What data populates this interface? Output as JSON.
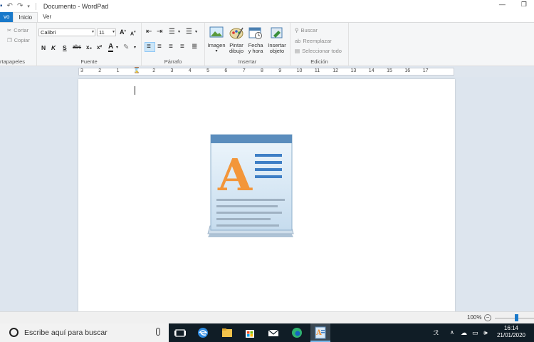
{
  "window": {
    "title": "Documento - WordPad",
    "minimize": "—",
    "restore": "❐"
  },
  "tabs": {
    "file": "vo",
    "home": "Inicio",
    "view": "Ver"
  },
  "clipboard": {
    "label": "rtapapeles",
    "cut": "Cortar",
    "copy": "Copiar"
  },
  "font": {
    "label": "Fuente",
    "family": "Calibri",
    "size": "11",
    "bold": "N",
    "italic": "K",
    "underline": "S",
    "strike": "abc",
    "sub": "x₂",
    "sup": "x²",
    "color_letter": "A"
  },
  "paragraph": {
    "label": "Párrafo"
  },
  "insert": {
    "label": "Insertar",
    "image": "Imagen",
    "paint1": "Pintar",
    "paint2": "dibujo",
    "date1": "Fecha",
    "date2": "y hora",
    "object1": "Insertar",
    "object2": "objeto"
  },
  "editing": {
    "label": "Edición",
    "find": "Buscar",
    "replace": "Reemplazar",
    "select_all": "Seleccionar todo"
  },
  "ruler": {
    "numbers": [
      "3",
      "2",
      "1",
      "1",
      "2",
      "3",
      "4",
      "5",
      "6",
      "7",
      "8",
      "9",
      "10",
      "11",
      "12",
      "13",
      "14",
      "15",
      "16",
      "17"
    ]
  },
  "status": {
    "zoom": "100%"
  },
  "taskbar": {
    "search_placeholder": "Escribe aquí para buscar",
    "time": "16:14",
    "date": "21/01/2020"
  }
}
